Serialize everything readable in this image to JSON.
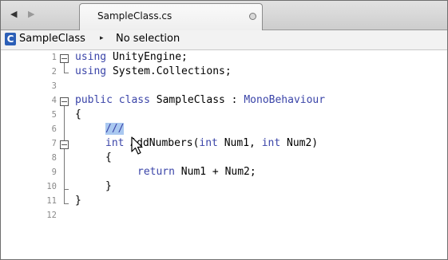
{
  "tab": {
    "title": "SampleClass.cs"
  },
  "breadcrumb": {
    "class_name": "SampleClass",
    "separator": "▸",
    "selection": "No selection",
    "class_icon": "C"
  },
  "editor": {
    "line_numbers": [
      "1",
      "2",
      "3",
      "4",
      "5",
      "6",
      "7",
      "8",
      "9",
      "10",
      "11",
      "12"
    ],
    "lines": {
      "l1_kw": "using",
      "l1_rest": " UnityEngine;",
      "l2_kw": "using",
      "l2_rest": " System.Collections;",
      "l4_kw1": "public",
      "l4_kw2": " class",
      "l4_name": " SampleClass :",
      "l4_base": " MonoBehaviour",
      "l5": "{",
      "l6_comment": "///",
      "l7_kw": "int",
      "l7_rest": " AddNumbers(",
      "l7_kw2": "int",
      "l7_mid": " Num1, ",
      "l7_kw3": "int",
      "l7_end": " Num2)",
      "l8": "{",
      "l9_kw": "return",
      "l9_rest": " Num1 + Num2;",
      "l10": "}",
      "l11": "}"
    }
  },
  "icons": {
    "back": "left-arrow-icon",
    "forward": "right-arrow-icon",
    "tab_dirty": "dot-icon",
    "cursor": "mouse-pointer-icon"
  }
}
